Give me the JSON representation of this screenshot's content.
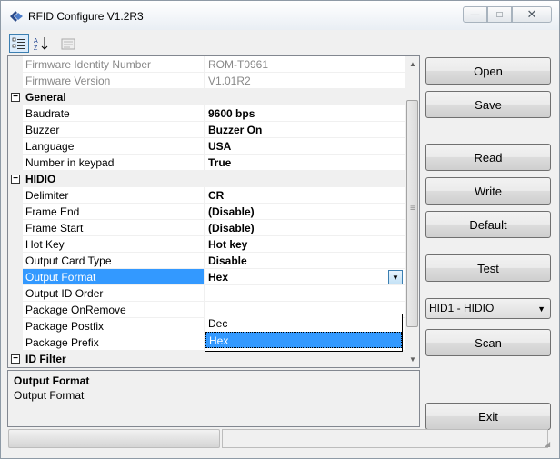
{
  "window": {
    "title": "RFID Configure V1.2R3",
    "controls": {
      "minimize": "—",
      "maximize": "□",
      "close": "✕"
    }
  },
  "toolbar": {
    "categorized_icon": "categorized-icon",
    "alphabetical_icon": "sort-alpha-icon",
    "pages_icon": "property-pages-icon"
  },
  "grid": {
    "rows": [
      {
        "type": "prop",
        "name": "Firmware Identity Number",
        "value": "ROM-T0961",
        "readonly": true
      },
      {
        "type": "prop",
        "name": "Firmware Version",
        "value": "V1.01R2",
        "readonly": true
      },
      {
        "type": "category",
        "name": "General",
        "expander": "−"
      },
      {
        "type": "prop",
        "name": "Baudrate",
        "value": "9600 bps"
      },
      {
        "type": "prop",
        "name": "Buzzer",
        "value": "Buzzer On"
      },
      {
        "type": "prop",
        "name": "Language",
        "value": "USA"
      },
      {
        "type": "prop",
        "name": "Number in keypad",
        "value": "True"
      },
      {
        "type": "category",
        "name": "HIDIO",
        "expander": "−"
      },
      {
        "type": "prop",
        "name": "Delimiter",
        "value": "CR"
      },
      {
        "type": "prop",
        "name": "Frame End",
        "value": "(Disable)"
      },
      {
        "type": "prop",
        "name": "Frame Start",
        "value": "(Disable)"
      },
      {
        "type": "prop",
        "name": "Hot Key",
        "value": "Hot key"
      },
      {
        "type": "prop",
        "name": "Output Card Type",
        "value": "Disable"
      },
      {
        "type": "prop",
        "name": "Output Format",
        "value": "Hex",
        "selected": true
      },
      {
        "type": "prop",
        "name": "Output ID Order",
        "value": ""
      },
      {
        "type": "prop",
        "name": "Package OnRemove",
        "value": ""
      },
      {
        "type": "prop",
        "name": "Package Postfix",
        "value": ""
      },
      {
        "type": "prop",
        "name": "Package Prefix",
        "value": ""
      },
      {
        "type": "category",
        "name": "ID Filter",
        "expander": "−"
      }
    ],
    "dropdown_options": [
      "Dec",
      "Hex"
    ],
    "dropdown_selected": "Hex"
  },
  "description": {
    "title": "Output Format",
    "text": "Output Format"
  },
  "buttons": {
    "open": "Open",
    "save": "Save",
    "read": "Read",
    "write": "Write",
    "default": "Default",
    "test": "Test",
    "scan": "Scan",
    "exit": "Exit"
  },
  "interface_select": {
    "value": "HID1 - HIDIO"
  }
}
